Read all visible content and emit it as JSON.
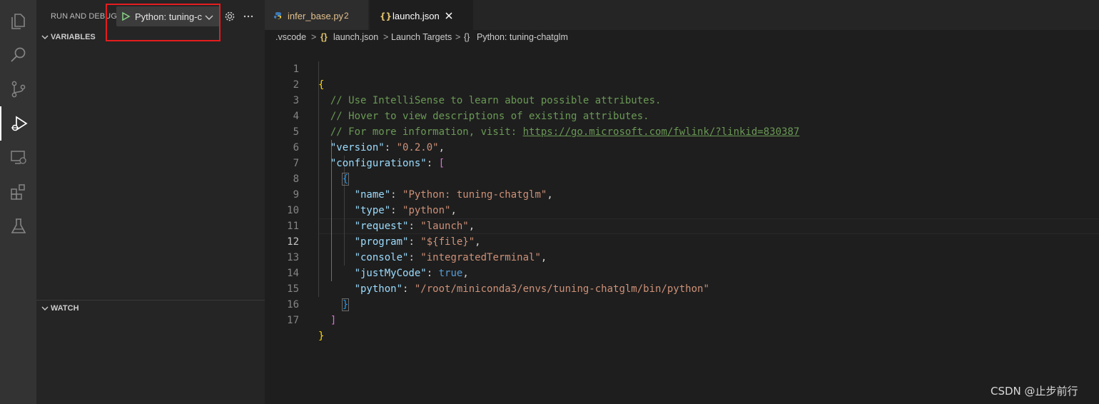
{
  "sidebar": {
    "title": "RUN AND DEBUG",
    "config_label": "Python: tuning-c",
    "sections": {
      "variables": "VARIABLES",
      "watch": "WATCH"
    }
  },
  "tabs": [
    {
      "label": "infer_base.py",
      "badge": "2",
      "icon": "python-icon"
    },
    {
      "label": "launch.json",
      "icon": "json-icon"
    }
  ],
  "breadcrumb": {
    "items": [
      ".vscode",
      "launch.json",
      "Launch Targets",
      "Python: tuning-chatglm"
    ],
    "separator": ">",
    "json_icon": "{}"
  },
  "editor": {
    "line_numbers": [
      "1",
      "2",
      "3",
      "4",
      "5",
      "6",
      "7",
      "8",
      "9",
      "10",
      "11",
      "12",
      "13",
      "14",
      "15",
      "16",
      "17"
    ],
    "active_line": "12",
    "tokens": {
      "open_brace": "{",
      "close_brace": "}",
      "open_bracket": "[",
      "close_bracket": "]",
      "comment1": "// Use IntelliSense to learn about possible attributes.",
      "comment2": "// Hover to view descriptions of existing attributes.",
      "comment3_prefix": "// For more information, visit: ",
      "comment3_link": "https://go.microsoft.com/fwlink/?linkid=830387",
      "k_version": "\"version\"",
      "v_version": "\"0.2.0\"",
      "k_configurations": "\"configurations\"",
      "k_name": "\"name\"",
      "v_name": "\"Python: tuning-chatglm\"",
      "k_type": "\"type\"",
      "v_type": "\"python\"",
      "k_request": "\"request\"",
      "v_request": "\"launch\"",
      "k_program": "\"program\"",
      "v_program": "\"${file}\"",
      "k_console": "\"console\"",
      "v_console": "\"integratedTerminal\"",
      "k_justmycode": "\"justMyCode\"",
      "v_justmycode": "true",
      "k_python": "\"python\"",
      "v_python": "\"/root/miniconda3/envs/tuning-chatglm/bin/python\"",
      "colon": ": ",
      "comma": ","
    }
  },
  "watermark": "CSDN @止步前行",
  "colors": {
    "accent_red_box": "#e51c1c",
    "play_green": "#89d185",
    "python_tab_label": "#e2c08d",
    "json_icon": "#e0c26e"
  }
}
